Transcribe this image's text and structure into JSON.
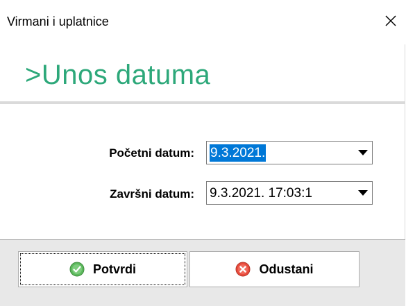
{
  "window": {
    "title": "Virmani i uplatnice",
    "close_glyph": "✕"
  },
  "heading": {
    "text": ">Unos datuma",
    "color": "#2da87a"
  },
  "form": {
    "start_date": {
      "label": "Početni datum:",
      "value": "9.3.2021."
    },
    "end_date": {
      "label": "Završni datum:",
      "value": "9.3.2021. 17:03:1"
    }
  },
  "buttons": {
    "confirm": {
      "label": "Potvrdi",
      "icon": "check-circle-icon",
      "icon_color": "#5cb85c"
    },
    "cancel": {
      "label": "Odustani",
      "icon": "cancel-circle-icon",
      "icon_color": "#e84b3c"
    }
  },
  "colors": {
    "selection": "#0078d7",
    "accent": "#2da87a"
  }
}
